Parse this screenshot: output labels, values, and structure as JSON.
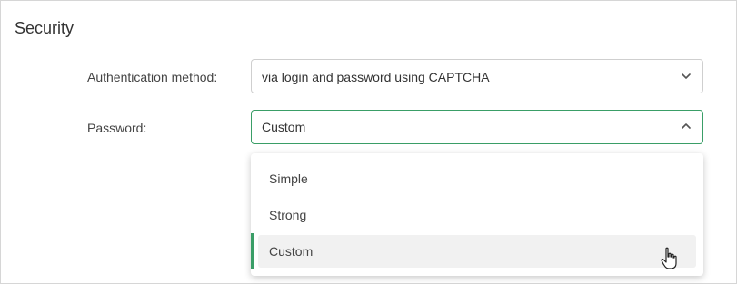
{
  "section": {
    "title": "Security"
  },
  "auth": {
    "label": "Authentication method:",
    "value": "via login and password using CAPTCHA"
  },
  "password": {
    "label": "Password:",
    "value": "Custom",
    "options": [
      "Simple",
      "Strong",
      "Custom"
    ],
    "selected_option": "Custom"
  },
  "colors": {
    "accent": "#3a9e67",
    "hover_bg": "#f1f1f1",
    "border": "#cfcfcf"
  },
  "icons": {
    "auth_chevron": "chevron-down-icon",
    "password_chevron": "chevron-up-icon",
    "cursor": "hand-pointer-cursor-icon"
  }
}
